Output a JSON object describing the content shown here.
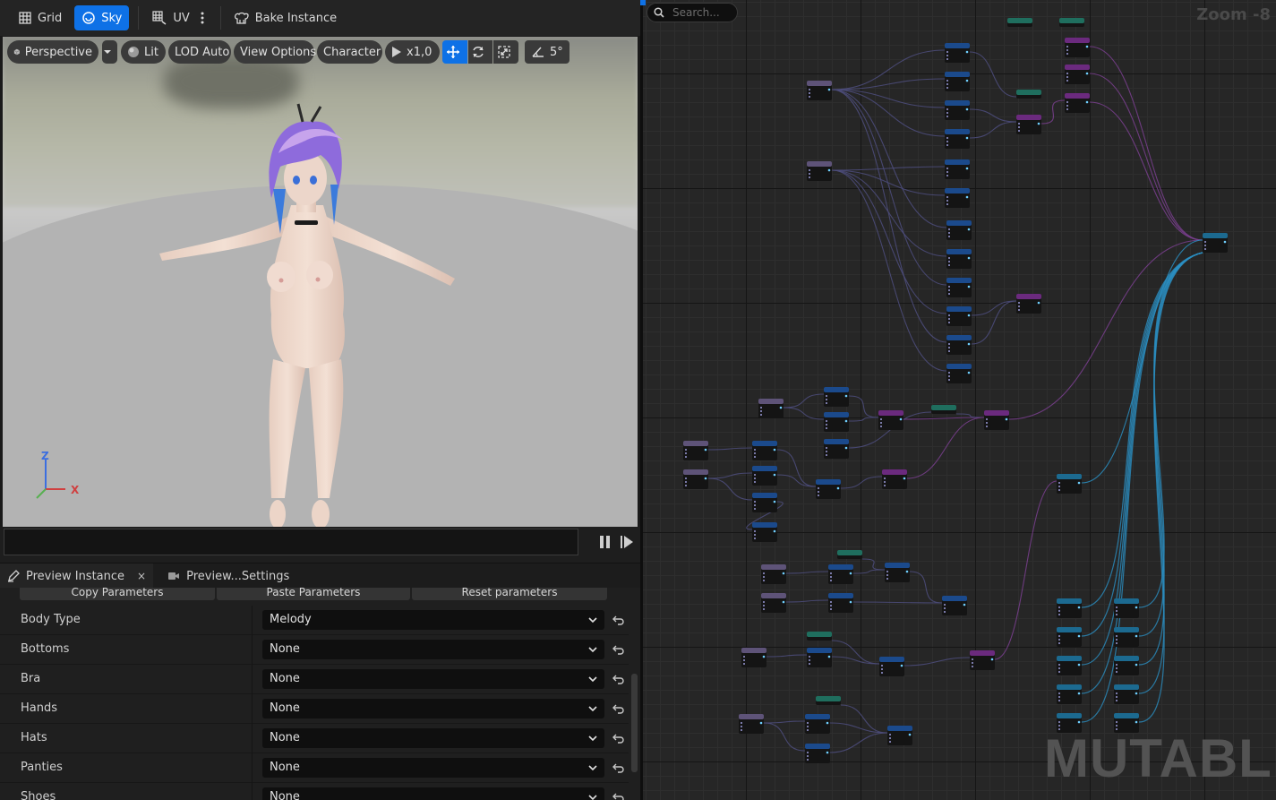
{
  "toolbar": {
    "grid_label": "Grid",
    "sky_label": "Sky",
    "uv_label": "UV",
    "bake_label": "Bake Instance"
  },
  "viewport_toolbar": {
    "perspective_label": "Perspective",
    "lit_label": "Lit",
    "lod_label": "LOD Auto",
    "view_options_label": "View Options",
    "character_label": "Character",
    "speed_label": "x1,0",
    "angle_label": "5°"
  },
  "axis": {
    "z": "Z",
    "x": "X"
  },
  "tabs": {
    "preview_instance": "Preview Instance",
    "preview_settings": "Preview...Settings",
    "close": "×"
  },
  "actions": {
    "copy": "Copy Parameters",
    "paste": "Paste Parameters",
    "reset": "Reset parameters"
  },
  "parameters": [
    {
      "label": "Body Type",
      "value": "Melody"
    },
    {
      "label": "Bottoms",
      "value": "None"
    },
    {
      "label": "Bra",
      "value": "None"
    },
    {
      "label": "Hands",
      "value": "None"
    },
    {
      "label": "Hats",
      "value": "None"
    },
    {
      "label": "Panties",
      "value": "None"
    },
    {
      "label": "Shoes",
      "value": "None"
    }
  ],
  "graph": {
    "search_placeholder": "Search...",
    "zoom_label": "Zoom -8",
    "watermark": "MUTABLE"
  },
  "colors": {
    "accent": "#0e71e6",
    "node_blue": "#1b4a8c",
    "node_purple": "#6b2a7e",
    "node_lavender": "#5e5378",
    "node_teal": "#1f6e5e",
    "node_cyan": "#1c6a90"
  }
}
